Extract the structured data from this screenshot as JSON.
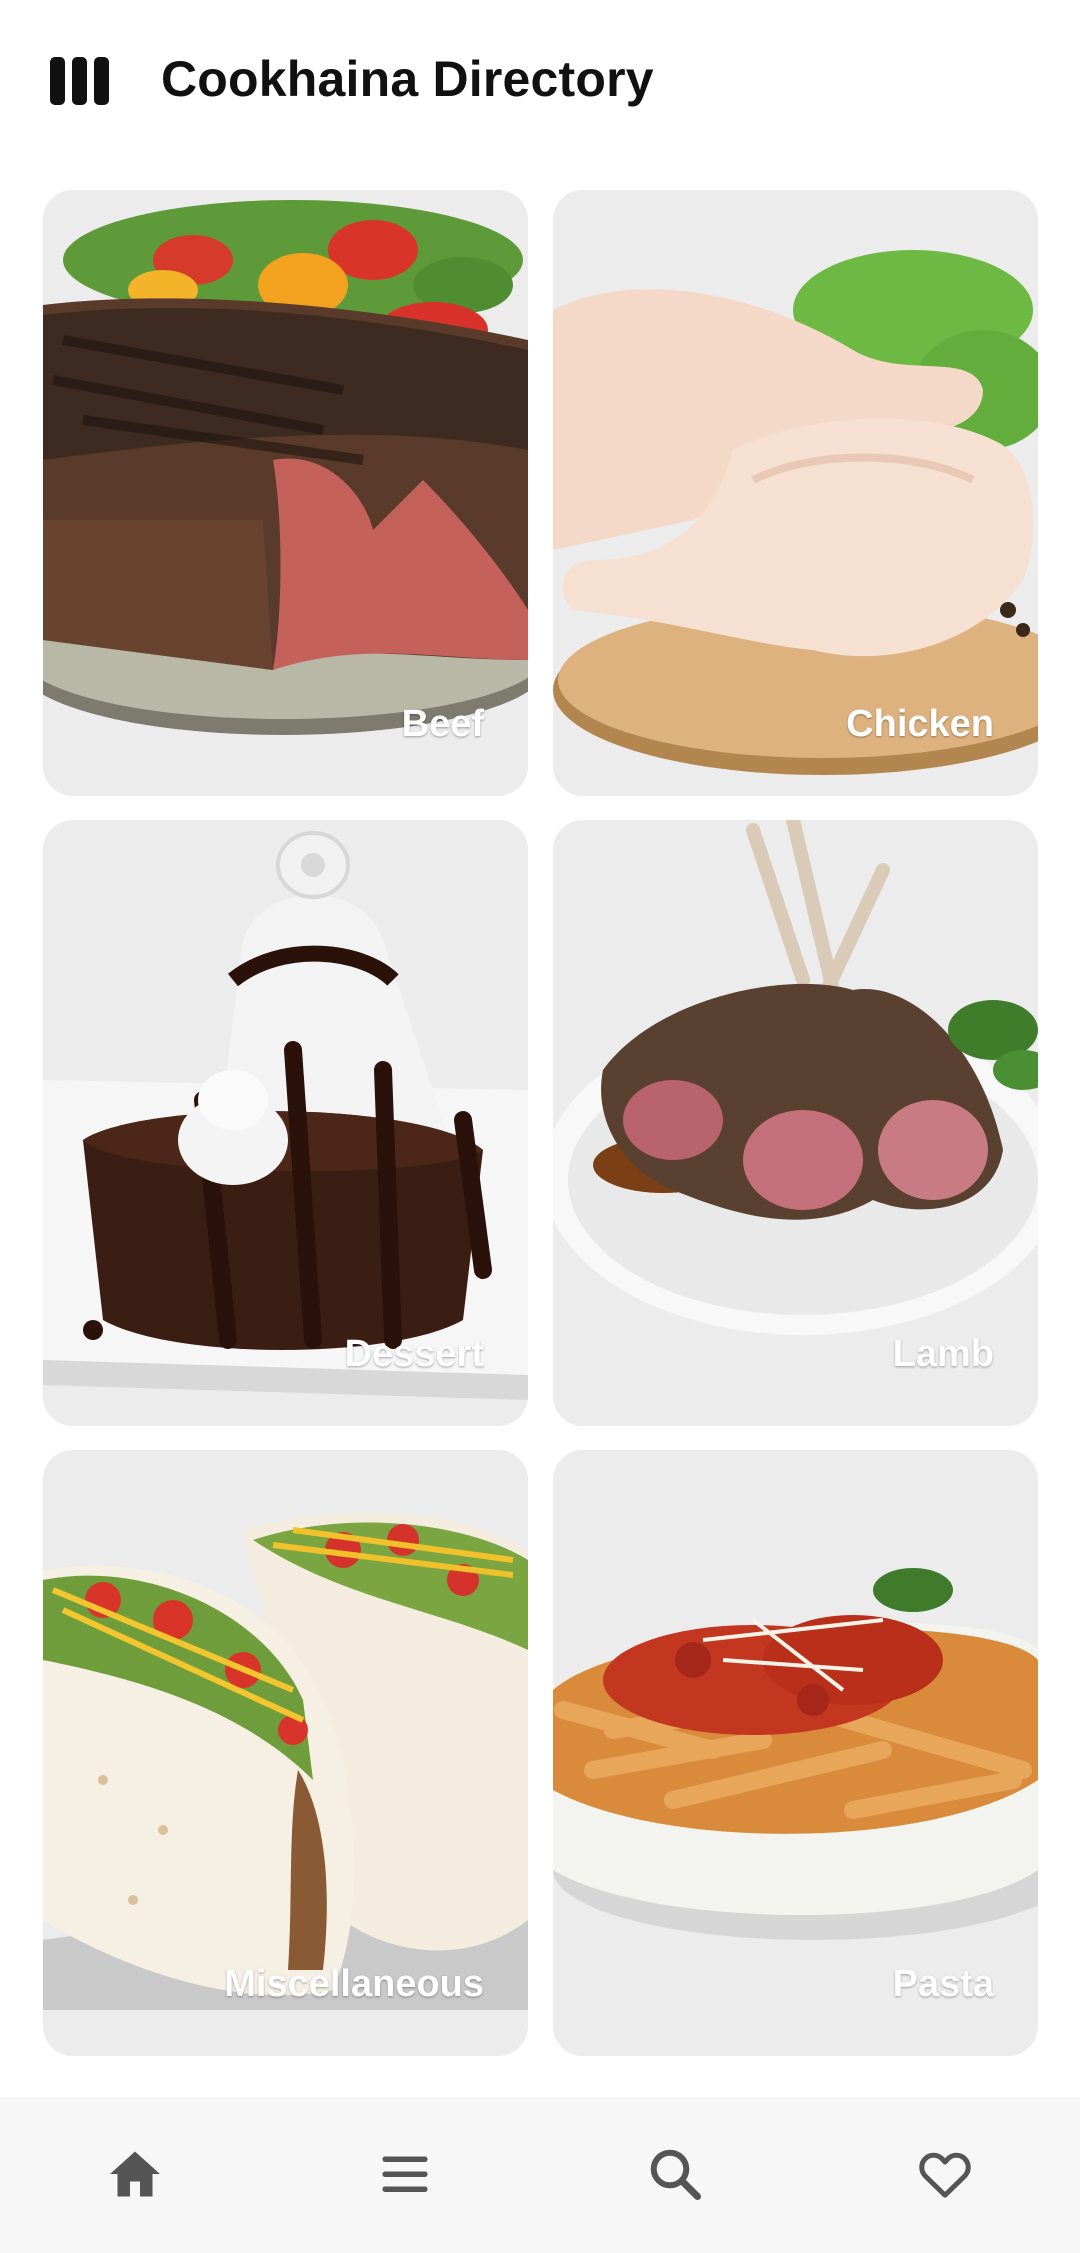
{
  "header": {
    "title": "Cookhaina Directory",
    "app_icon": "three-bars-icon"
  },
  "categories": [
    {
      "label": "Beef"
    },
    {
      "label": "Chicken"
    },
    {
      "label": "Dessert"
    },
    {
      "label": "Lamb"
    },
    {
      "label": "Miscellaneous"
    },
    {
      "label": "Pasta"
    }
  ],
  "bottom_nav": {
    "items": [
      {
        "icon": "home-icon"
      },
      {
        "icon": "menu-icon"
      },
      {
        "icon": "search-icon"
      },
      {
        "icon": "heart-icon"
      }
    ]
  },
  "colors": {
    "card_background": "#ececec",
    "label_text": "#ffffff",
    "title_text": "#111111",
    "nav_icon": "#555555"
  }
}
